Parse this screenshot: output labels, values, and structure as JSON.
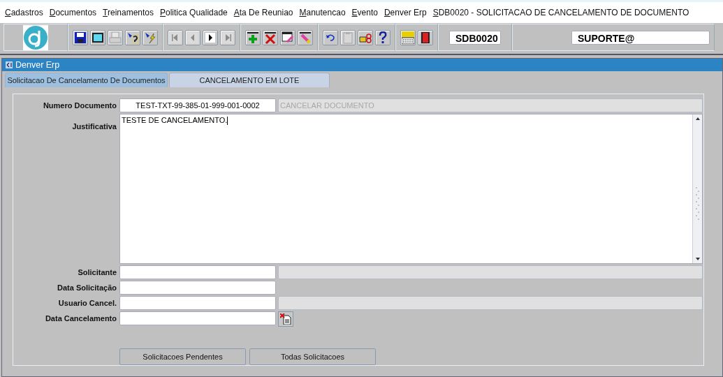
{
  "menu": [
    {
      "label": "Cadastros"
    },
    {
      "label": "Documentos"
    },
    {
      "label": "Treinamentos"
    },
    {
      "label": "Politica Qualidade"
    },
    {
      "label": "Ata De Reuniao"
    },
    {
      "label": "Manutencao"
    },
    {
      "label": "Evento"
    },
    {
      "label": "Denver Erp"
    },
    {
      "label": "SDB0020 - SOLICITACAO DE CANCELAMENTO DE DOCUMENTO"
    }
  ],
  "toolbar": {
    "groups": [
      [
        {
          "kind": "save",
          "disabled": false
        },
        {
          "kind": "screen",
          "disabled": false
        },
        {
          "kind": "print",
          "disabled": true
        },
        {
          "kind": "query",
          "disabled": false
        },
        {
          "kind": "execute",
          "disabled": false
        }
      ],
      [
        {
          "kind": "first",
          "disabled": true
        },
        {
          "kind": "prev",
          "disabled": true
        },
        {
          "kind": "next",
          "disabled": false
        },
        {
          "kind": "last",
          "disabled": true
        }
      ],
      [
        {
          "kind": "add",
          "disabled": false
        },
        {
          "kind": "delete",
          "disabled": false
        },
        {
          "kind": "edit",
          "disabled": false
        },
        {
          "kind": "clear",
          "disabled": false
        }
      ],
      [
        {
          "kind": "undo",
          "disabled": false
        },
        {
          "kind": "paste",
          "disabled": true
        },
        {
          "kind": "hand",
          "disabled": false
        },
        {
          "kind": "help",
          "disabled": false
        }
      ],
      [
        {
          "kind": "menu",
          "disabled": false
        },
        {
          "kind": "exit",
          "disabled": false
        }
      ]
    ],
    "form_code": "SDB0020",
    "user": "SUPORTE@"
  },
  "window": {
    "title": "Denver Erp"
  },
  "tabs": [
    {
      "label": "Solicitacao De Cancelamento De Documentos",
      "selected": true
    },
    {
      "label": "CANCELAMENTO EM LOTE",
      "selected": false
    }
  ],
  "fields": [
    {
      "kind": "input",
      "label": "Numero Documento",
      "value": "TEST-TXT-99-385-01-999-001-0002",
      "side": {
        "kind": "button",
        "label": "CANCELAR DOCUMENTO",
        "disabled": true
      }
    },
    {
      "kind": "textarea",
      "label": "Justificativa",
      "value": "TESTE DE CANCELAMENTO."
    },
    {
      "kind": "input",
      "label": "Solicitante",
      "side": {
        "kind": "display"
      }
    },
    {
      "kind": "input",
      "label": "Data Solicitação"
    },
    {
      "kind": "input",
      "label": "Usuario Cancel.",
      "side": {
        "kind": "display"
      }
    },
    {
      "kind": "input",
      "label": "Data Cancelamento",
      "side": {
        "kind": "calendar"
      }
    }
  ],
  "buttons": [
    {
      "label": "Solicitacoes Pendentes"
    },
    {
      "label": "Todas Solicitacoes"
    }
  ]
}
